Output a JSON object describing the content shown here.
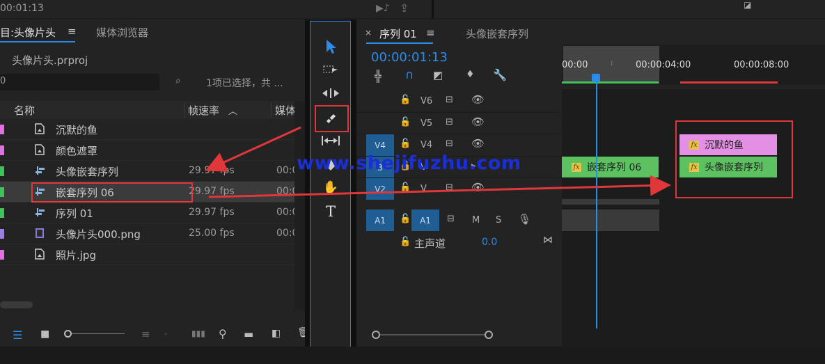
{
  "top": {
    "timecode_partial": "00:01:13"
  },
  "project": {
    "tab_project": "目:头像片头",
    "tab_media": "媒体浏览器",
    "menu_glyph": "≡",
    "file_name": "头像片头.prproj",
    "search_value": "0",
    "selection_status": "1项已选择，共 ...",
    "columns": {
      "name": "名称",
      "fps": "帧速率",
      "media": "媒体"
    },
    "items": [
      {
        "name": "沉默的鱼",
        "fps": "",
        "media": "",
        "color": "#e171e1",
        "icon": "sequence-file-icon"
      },
      {
        "name": "颜色遮罩",
        "fps": "",
        "media": "",
        "color": "#e171e1",
        "icon": "sequence-file-icon"
      },
      {
        "name": "头像嵌套序列",
        "fps": "29.97 fps",
        "media": "00:0",
        "color": "#3ec25a",
        "icon": "sequence-icon"
      },
      {
        "name": "嵌套序列 06",
        "fps": "29.97 fps",
        "media": "00:0",
        "color": "#3ec25a",
        "icon": "sequence-icon"
      },
      {
        "name": "序列 01",
        "fps": "29.97 fps",
        "media": "00:0",
        "color": "#3ec25a",
        "icon": "sequence-icon"
      },
      {
        "name": "头像片头000.png",
        "fps": "25.00 fps",
        "media": "00:0",
        "color": "#9b7ee6",
        "icon": "film-icon"
      },
      {
        "name": "照片.jpg",
        "fps": "",
        "media": "",
        "color": "#e171e1",
        "icon": "image-file-icon"
      }
    ]
  },
  "timeline": {
    "close": "×",
    "tab_sequence": "序列 01",
    "menu_glyph": "≡",
    "tab_nested": "头像嵌套序列",
    "timecode": "00:00:01:13",
    "ruler": [
      "00:00",
      "00:00:04:00",
      "00:00:08:00"
    ],
    "tracks": {
      "v6": "V6",
      "v5": "V5",
      "v4": "V4",
      "v4_target": "V4",
      "v3_src": "3",
      "v3": "V",
      "v2": "V2",
      "v2_target": "V",
      "a1_src": "A1",
      "a1": "A1",
      "mute": "M",
      "solo": "S",
      "master_label": "主声道",
      "master_value": "0.0"
    },
    "clips": {
      "c1": "嵌套序列 06",
      "c2": "沉默的鱼",
      "c3": "头像嵌套序列"
    },
    "fx_label": "fx"
  },
  "watermark": "www.shejifuzhu.com",
  "colors": {
    "accent": "#2d8ceb",
    "annotation": "#e0383a",
    "clip_green": "#5cc160",
    "clip_pink": "#e38fe3"
  }
}
